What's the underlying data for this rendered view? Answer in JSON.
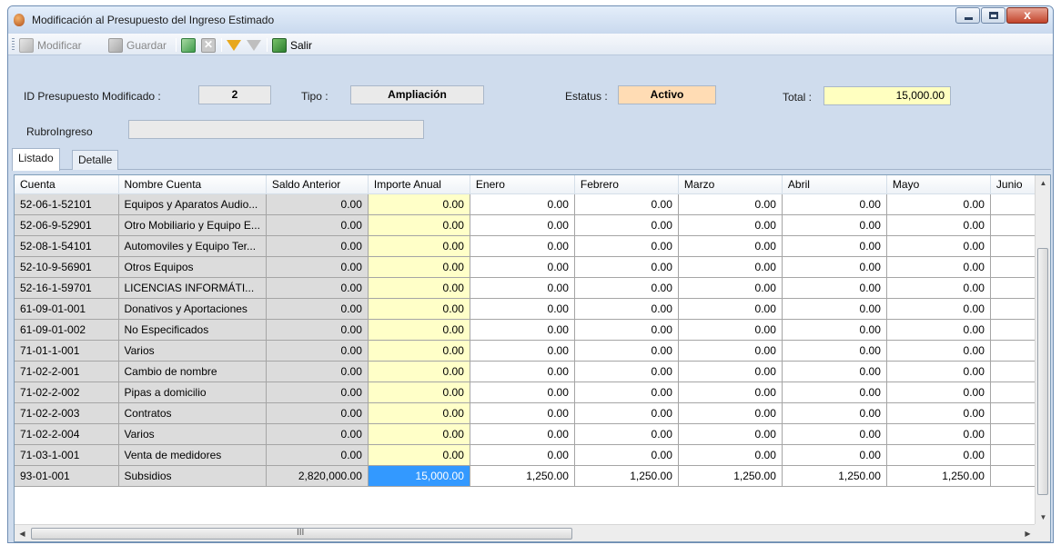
{
  "window": {
    "title": "Modificación al Presupuesto del Ingreso Estimado"
  },
  "toolbar": {
    "modificar": "Modificar",
    "guardar": "Guardar",
    "salir": "Salir"
  },
  "header": {
    "id_label": "ID Presupuesto Modificado :",
    "id_value": "2",
    "tipo_label": "Tipo :",
    "tipo_value": "Ampliación",
    "estatus_label": "Estatus :",
    "estatus_value": "Activo",
    "total_label": "Total :",
    "total_value": "15,000.00",
    "rubro_label": "RubroIngreso",
    "rubro_value": ""
  },
  "tabs": [
    "Listado",
    "Detalle"
  ],
  "colors": {
    "estatus_bg": "#ffdcb4",
    "total_bg": "#ffffc0",
    "selected_cell": "#3399ff"
  },
  "grid": {
    "columns": [
      "Cuenta",
      "Nombre Cuenta",
      "Saldo Anterior",
      "Importe Anual",
      "Enero",
      "Febrero",
      "Marzo",
      "Abril",
      "Mayo",
      "Junio"
    ],
    "rows": [
      [
        "52-06-1-52101",
        "Equipos y Aparatos Audio...",
        "0.00",
        "0.00",
        "0.00",
        "0.00",
        "0.00",
        "0.00",
        "0.00",
        ""
      ],
      [
        "52-06-9-52901",
        "Otro Mobiliario y Equipo E...",
        "0.00",
        "0.00",
        "0.00",
        "0.00",
        "0.00",
        "0.00",
        "0.00",
        ""
      ],
      [
        "52-08-1-54101",
        "Automoviles y Equipo Ter...",
        "0.00",
        "0.00",
        "0.00",
        "0.00",
        "0.00",
        "0.00",
        "0.00",
        ""
      ],
      [
        "52-10-9-56901",
        "Otros Equipos",
        "0.00",
        "0.00",
        "0.00",
        "0.00",
        "0.00",
        "0.00",
        "0.00",
        ""
      ],
      [
        "52-16-1-59701",
        "LICENCIAS INFORMÁTI...",
        "0.00",
        "0.00",
        "0.00",
        "0.00",
        "0.00",
        "0.00",
        "0.00",
        ""
      ],
      [
        "61-09-01-001",
        "Donativos y Aportaciones",
        "0.00",
        "0.00",
        "0.00",
        "0.00",
        "0.00",
        "0.00",
        "0.00",
        ""
      ],
      [
        "61-09-01-002",
        "No Especificados",
        "0.00",
        "0.00",
        "0.00",
        "0.00",
        "0.00",
        "0.00",
        "0.00",
        ""
      ],
      [
        "71-01-1-001",
        "Varios",
        "0.00",
        "0.00",
        "0.00",
        "0.00",
        "0.00",
        "0.00",
        "0.00",
        ""
      ],
      [
        "71-02-2-001",
        "Cambio de nombre",
        "0.00",
        "0.00",
        "0.00",
        "0.00",
        "0.00",
        "0.00",
        "0.00",
        ""
      ],
      [
        "71-02-2-002",
        "Pipas a domicilio",
        "0.00",
        "0.00",
        "0.00",
        "0.00",
        "0.00",
        "0.00",
        "0.00",
        ""
      ],
      [
        "71-02-2-003",
        "Contratos",
        "0.00",
        "0.00",
        "0.00",
        "0.00",
        "0.00",
        "0.00",
        "0.00",
        ""
      ],
      [
        "71-02-2-004",
        "Varios",
        "0.00",
        "0.00",
        "0.00",
        "0.00",
        "0.00",
        "0.00",
        "0.00",
        ""
      ],
      [
        "71-03-1-001",
        "Venta de medidores",
        "0.00",
        "0.00",
        "0.00",
        "0.00",
        "0.00",
        "0.00",
        "0.00",
        ""
      ],
      [
        "93-01-001",
        "Subsidios",
        "2,820,000.00",
        "15,000.00",
        "1,250.00",
        "1,250.00",
        "1,250.00",
        "1,250.00",
        "1,250.00",
        ""
      ]
    ],
    "selected_row": 13
  }
}
